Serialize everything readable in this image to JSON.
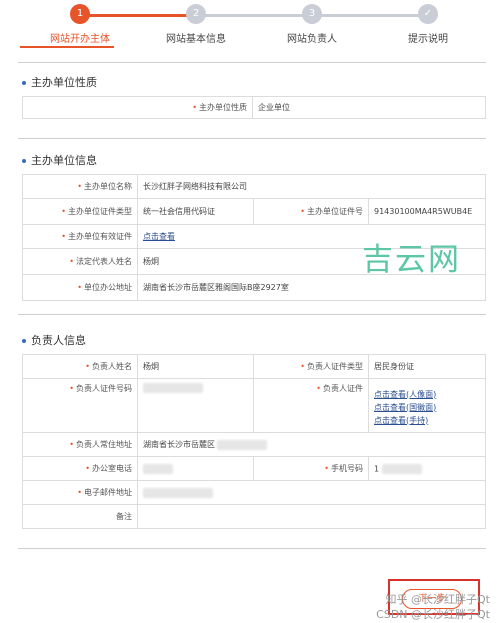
{
  "steps": [
    {
      "num": "1",
      "label": "网站开办主体"
    },
    {
      "num": "2",
      "label": "网站基本信息"
    },
    {
      "num": "3",
      "label": "网站负责人"
    },
    {
      "num": "✓",
      "label": "提示说明"
    }
  ],
  "section1": {
    "title": "主办单位性质",
    "nature_label": "主办单位性质",
    "nature_value": "企业单位"
  },
  "section2": {
    "title": "主办单位信息",
    "name_label": "主办单位名称",
    "name_value": "长沙红胖子网络科技有限公司",
    "cert_type_label": "主办单位证件类型",
    "cert_type_value": "统一社会信用代码证",
    "cert_no_label": "主办单位证件号",
    "cert_no_value": "91430100MA4R5WUB4E",
    "valid_cert_label": "主办单位有效证件",
    "valid_cert_link": "点击查看",
    "legal_label": "法定代表人姓名",
    "legal_value": "杨炯",
    "address_label": "单位办公地址",
    "address_value": "湖南省长沙市岳麓区雅阁国际B座2927室"
  },
  "section3": {
    "title": "负责人信息",
    "person_name_label": "负责人姓名",
    "person_name_value": "杨炯",
    "person_cert_type_label": "负责人证件类型",
    "person_cert_type_value": "居民身份证",
    "person_cert_no_label": "负责人证件号码",
    "person_cert_label": "负责人证件",
    "person_cert_links": [
      "点击查看(人像面)",
      "点击查看(国徽面)",
      "点击查看(手持)"
    ],
    "person_address_label": "负责人常住地址",
    "person_address_value": "湖南省长沙市岳麓区",
    "office_phone_label": "办公室电话",
    "mobile_label": "手机号码",
    "mobile_value": "1",
    "email_label": "电子邮件地址",
    "note_label": "备注"
  },
  "watermark": "吉云网",
  "next_button": "下一步",
  "credit": {
    "line1": "知乎 @长沙红胖子Qt",
    "line2": "CSDN @长沙红胖子Qt"
  }
}
